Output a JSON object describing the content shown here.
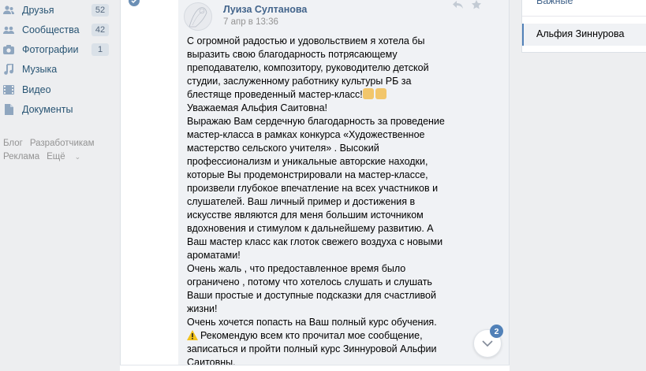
{
  "nav": {
    "items": [
      {
        "label": "Друзья",
        "count": "52",
        "icon": "people-icon"
      },
      {
        "label": "Сообщества",
        "count": "42",
        "icon": "groups-icon"
      },
      {
        "label": "Фотографии",
        "count": "1",
        "icon": "camera-icon"
      },
      {
        "label": "Музыка",
        "count": "",
        "icon": "music-icon"
      },
      {
        "label": "Видео",
        "count": "",
        "icon": "video-icon"
      },
      {
        "label": "Документы",
        "count": "",
        "icon": "document-icon"
      }
    ],
    "footer": {
      "blog": "Блог",
      "developers": "Разработчикам",
      "ads": "Реклама",
      "more": "Ещё"
    }
  },
  "post": {
    "author": "Луиза Султанова",
    "date": "7 апр в 13:36",
    "lines": [
      "С огромной радостью и удовольствием я хотела бы",
      "выразить свою благодарность потрясающему",
      "преподавателю, композитору, руководителю детской",
      "студии, заслуженному работнику культуры РБ за",
      "блестяще проведенный мастер-класс!",
      "Уважаемая Альфия Саитовна!",
      "Выражаю Вам сердечную благодарность за проведение",
      "мастер-класса в рамках конкурса «Художественное",
      "мастерство сельского учителя» . Высокий",
      "профессионализм и уникальные авторские находки,",
      "которые Вы продемонстрировали на мастер-классе,",
      "произвели глубокое впечатление на всех участников и",
      "слушателей. Ваш личный пример и достижения в",
      "искусстве являются для меня большим источником",
      "вдохновения и стимулом к дальнейшему развитию. А",
      "Ваш мастер класс как глоток свежего воздуха с новыми",
      "ароматами!",
      "Очень жаль , что предоставленное время было",
      "ограничено , потому что хотелось слушать и слушать",
      "Ваши простые и доступные подсказки для счастливой",
      "жизни!",
      "Очень хочется попасть на Ваш полный курс обучения.",
      "Рекомендую всем кто прочитал мое сообщение,",
      "записаться и пройти полный курс Зиннуровой Альфии",
      "Саитовны."
    ]
  },
  "scroll": {
    "badge": "2"
  },
  "right_panel": {
    "top_item": "Важные",
    "active_item": "Альфия Зиннурова"
  },
  "colors": {
    "link": "#285473",
    "author": "#42648b",
    "accent": "#5181b8",
    "background": "#edeef0"
  }
}
